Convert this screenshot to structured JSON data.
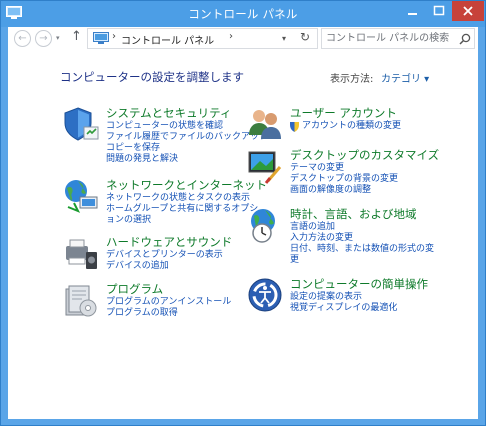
{
  "window": {
    "title": "コントロール パネル"
  },
  "nav": {
    "back_glyph": "←",
    "forward_glyph": "→",
    "recent_glyph": "▾",
    "up_glyph": "↑",
    "breadcrumb_sep": "›",
    "breadcrumb": "コントロール パネル",
    "breadcrumb_trail_sep": "›",
    "dropdown_glyph": "▾",
    "refresh_glyph": "↻",
    "search_placeholder": "コントロール パネルの検索"
  },
  "main": {
    "heading": "コンピューターの設定を調整します",
    "view_by_label": "表示方法:",
    "view_by_value": "カテゴリ ▾"
  },
  "categories_left": [
    {
      "title": "システムとセキュリティ",
      "icon": "system-security-icon",
      "links": [
        "コンピューターの状態を確認",
        "ファイル履歴でファイルのバックアップ",
        "コピーを保存",
        "問題の発見と解決"
      ]
    },
    {
      "title": "ネットワークとインターネット",
      "icon": "network-internet-icon",
      "links": [
        "ネットワークの状態とタスクの表示",
        "ホームグループと共有に関するオプシ",
        "ョンの選択"
      ]
    },
    {
      "title": "ハードウェアとサウンド",
      "icon": "hardware-sound-icon",
      "links": [
        "デバイスとプリンターの表示",
        "デバイスの追加"
      ]
    },
    {
      "title": "プログラム",
      "icon": "programs-icon",
      "links": [
        "プログラムのアンインストール",
        "プログラムの取得"
      ]
    }
  ],
  "categories_right": [
    {
      "title": "ユーザー アカウント",
      "icon": "user-accounts-icon",
      "links": [
        "アカウントの種類の変更"
      ]
    },
    {
      "title": "デスクトップのカスタマイズ",
      "icon": "appearance-personalization-icon",
      "links": [
        "テーマの変更",
        "デスクトップの背景の変更",
        "画面の解像度の調整"
      ]
    },
    {
      "title": "時計、言語、および地域",
      "icon": "clock-language-region-icon",
      "links": [
        "言語の追加",
        "入力方法の変更",
        "日付、時刻、または数値の形式の変",
        "更"
      ]
    },
    {
      "title": "コンピューターの簡単操作",
      "icon": "ease-of-access-icon",
      "links": [
        "設定の提案の表示",
        "視覚ディスプレイの最適化"
      ]
    }
  ],
  "colors": {
    "frame": "#5aa5e8",
    "category_title": "#0e7a2a",
    "link": "#1451b5",
    "heading": "#1e3287",
    "close_button": "#c7423a"
  }
}
